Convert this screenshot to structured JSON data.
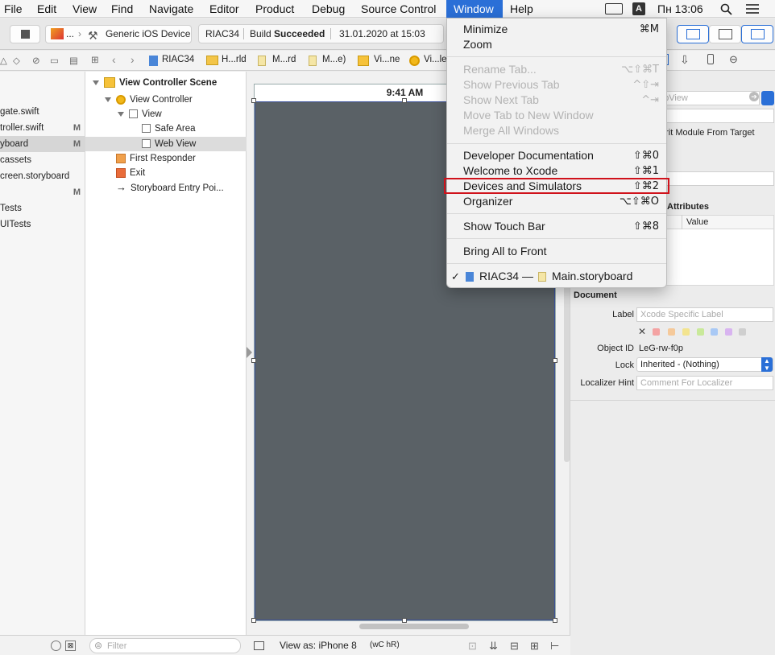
{
  "menubar": {
    "items": [
      "File",
      "Edit",
      "View",
      "Find",
      "Navigate",
      "Editor",
      "Product",
      "Debug",
      "Source Control",
      "Window",
      "Help"
    ],
    "active": "Window",
    "clock": "Пн 13:06",
    "input_badge": "A"
  },
  "toolbar": {
    "scheme_ellipsis": "...",
    "device": "Generic iOS Device",
    "project": "RIAC34",
    "build_prefix": "Build",
    "build_status": "Succeeded",
    "build_time": "31.01.2020 at 15:03"
  },
  "jumpbar": {
    "crumbs": [
      "RIAC34",
      "H...rld",
      "M...rd",
      "M...e)",
      "Vi...ne",
      "Vi...le"
    ]
  },
  "navigator": {
    "items": [
      {
        "label": "gate.swift",
        "badge": ""
      },
      {
        "label": "troller.swift",
        "badge": "M"
      },
      {
        "label": "yboard",
        "badge": "M"
      },
      {
        "label": "cassets",
        "badge": ""
      },
      {
        "label": "creen.storyboard",
        "badge": ""
      },
      {
        "label": "",
        "badge": "M"
      },
      {
        "label": "Tests",
        "badge": ""
      },
      {
        "label": "UITests",
        "badge": ""
      }
    ],
    "filter_placeholder": "Filter"
  },
  "outline": {
    "scene": "View Controller Scene",
    "view_controller": "View Controller",
    "view": "View",
    "safe_area": "Safe Area",
    "web_view": "Web View",
    "first_responder": "First Responder",
    "exit": "Exit",
    "entry_point": "Storyboard Entry Poi..."
  },
  "canvas": {
    "status_time": "9:41 AM",
    "view_as_label": "View as: iPhone 8",
    "size_class": "(wC hR)"
  },
  "window_menu": {
    "groups": [
      [
        {
          "label": "Minimize",
          "shortcut": "⌘M",
          "enabled": true
        },
        {
          "label": "Zoom",
          "shortcut": "",
          "enabled": true
        }
      ],
      [
        {
          "label": "Rename Tab...",
          "shortcut": "⌥⇧⌘T",
          "enabled": false
        },
        {
          "label": "Show Previous Tab",
          "shortcut": "^⇧⇥",
          "enabled": false
        },
        {
          "label": "Show Next Tab",
          "shortcut": "^⇥",
          "enabled": false
        },
        {
          "label": "Move Tab to New Window",
          "shortcut": "",
          "enabled": false
        },
        {
          "label": "Merge All Windows",
          "shortcut": "",
          "enabled": false
        }
      ],
      [
        {
          "label": "Developer Documentation",
          "shortcut": "⇧⌘0",
          "enabled": true
        },
        {
          "label": "Welcome to Xcode",
          "shortcut": "⇧⌘1",
          "enabled": true
        },
        {
          "label": "Devices and Simulators",
          "shortcut": "⇧⌘2",
          "enabled": true,
          "highlighted": true
        },
        {
          "label": "Organizer",
          "shortcut": "⌥⇧⌘O",
          "enabled": true
        }
      ],
      [
        {
          "label": "Show Touch Bar",
          "shortcut": "⇧⌘8",
          "enabled": true
        }
      ],
      [
        {
          "label": "Bring All to Front",
          "shortcut": "",
          "enabled": true
        }
      ]
    ],
    "window_entry": {
      "check": "✓",
      "project": "RIAC34",
      "separator": "—",
      "file": "Main.storyboard"
    }
  },
  "inspector": {
    "class_placeholder": "ebView",
    "inherit_label": "erit Module From Target",
    "attributes_header": "Attributes",
    "value_header": "Value",
    "document_header": "Document",
    "label_label": "Label",
    "label_placeholder": "Xcode Specific Label",
    "object_id_label": "Object ID",
    "object_id_value": "LeG-rw-f0p",
    "lock_label": "Lock",
    "lock_value": "Inherited - (Nothing)",
    "localizer_label": "Localizer Hint",
    "localizer_placeholder": "Comment For Localizer",
    "swatch_colors": [
      "#f4a3a3",
      "#f5c99a",
      "#f3e48f",
      "#c9e99a",
      "#a9c9f5",
      "#d8b4f0",
      "#cfcfcf"
    ]
  },
  "colors": {
    "menu_highlight": "#2a6fd7",
    "annotation_red": "#d0121b",
    "screen_gray": "#5a6166"
  }
}
